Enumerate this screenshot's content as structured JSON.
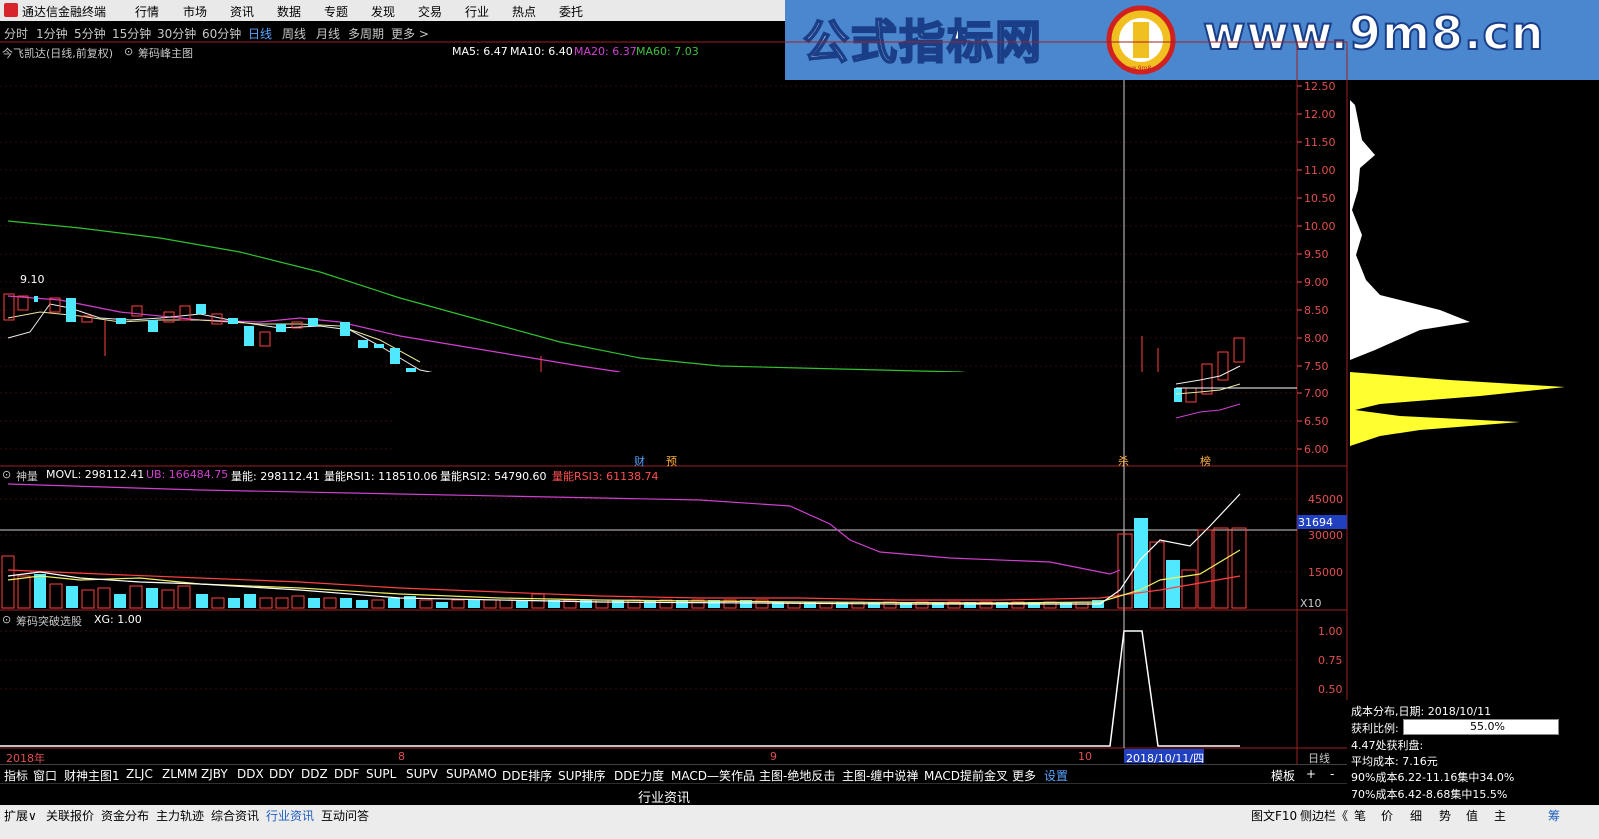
{
  "app": {
    "title": "通达信金融终端"
  },
  "menu": [
    "行情",
    "市场",
    "资讯",
    "数据",
    "专题",
    "发现",
    "交易",
    "行业",
    "热点",
    "委托"
  ],
  "periods": [
    "分时",
    "1分钟",
    "5分钟",
    "15分钟",
    "30分钟",
    "60分钟",
    "日线",
    "周线",
    "月线",
    "多周期",
    "更多 >"
  ],
  "active_period": "日线",
  "brand": {
    "left": "公式指标网",
    "right": "www.9m8.cn",
    "logo_text": "www.9m8.cn"
  },
  "main_panel": {
    "stock": "今飞凯达(日线,前复权)",
    "indicator": "筹码峰主图",
    "ma": [
      {
        "label": "MA5: 6.47",
        "color": "#ffffff"
      },
      {
        "label": "MA10: 6.40",
        "color": "#ffffff"
      },
      {
        "label": "MA20: 6.37",
        "color": "#d040d0"
      },
      {
        "label": "MA60: 7.03",
        "color": "#40c040"
      }
    ],
    "price_labels": [
      "12.50",
      "12.00",
      "11.50",
      "11.00",
      "10.50",
      "10.00",
      "9.50",
      "9.00",
      "8.50",
      "8.00",
      "7.50",
      "7.00",
      "6.50",
      "6.00"
    ],
    "high_marker": "9.10",
    "event_marks": [
      "财",
      "预",
      "杀",
      "榜"
    ]
  },
  "volume_panel": {
    "indicator": "神量",
    "values": [
      {
        "label": "MOVL: 298112.41",
        "color": "#ffffff"
      },
      {
        "label": "UB: 166484.75",
        "color": "#d040d0"
      },
      {
        "label": "量能: 298112.41",
        "color": "#ffffff"
      },
      {
        "label": "量能RSI1: 118510.06",
        "color": "#ffffff"
      },
      {
        "label": "量能RSI2: 54790.60",
        "color": "#ffffff"
      },
      {
        "label": "量能RSI3: 61138.74",
        "color": "#ff5050"
      }
    ],
    "axis": [
      "45000",
      "30000",
      "15000"
    ],
    "highlight_value": "31694",
    "unit": "X10"
  },
  "signal_panel": {
    "indicator": "筹码突破选股",
    "value": "XG: 1.00",
    "axis": [
      "1.00",
      "0.75",
      "0.50"
    ]
  },
  "time_axis": {
    "labels": [
      "2018年",
      "8",
      "9",
      "10"
    ],
    "cursor_date": "2018/10/11/四",
    "period": "日线"
  },
  "chip_info": {
    "date_line": "成本分布,日期: 2018/10/11",
    "profit_label": "获利比例:",
    "profit_value": "55.0%",
    "profit_price": "4.47处获利盘:",
    "avg_cost": "平均成本: 7.16元",
    "cost90": "90%成本6.22-11.16集中34.0%",
    "cost70": "70%成本6.42-8.68集中15.5%"
  },
  "bottom_tabs": [
    "指标",
    "窗口",
    "财神主图1",
    "ZLJC",
    "ZLMM",
    "ZJBY",
    "DDX",
    "DDY",
    "DDZ",
    "DDF",
    "SUPL",
    "SUPV",
    "SUPAMO",
    "DDE排序",
    "SUP排序",
    "DDE力度",
    "MACD—笑作品",
    "主图-绝地反击",
    "主图-缠中说禅",
    "MACD提前金叉",
    "更多",
    "设置"
  ],
  "bottom_tabs_right": [
    "模板",
    "+",
    "-"
  ],
  "news_label": "行业资讯",
  "status_bar": [
    "扩展∨",
    "关联报价",
    "资金分布",
    "主力轨迹",
    "综合资讯",
    "行业资讯",
    "互动问答"
  ],
  "status_right": [
    "图文F10",
    "侧边栏《"
  ],
  "status_icons": [
    "笔",
    "价",
    "细",
    "势",
    "值",
    "主",
    "筹"
  ]
}
